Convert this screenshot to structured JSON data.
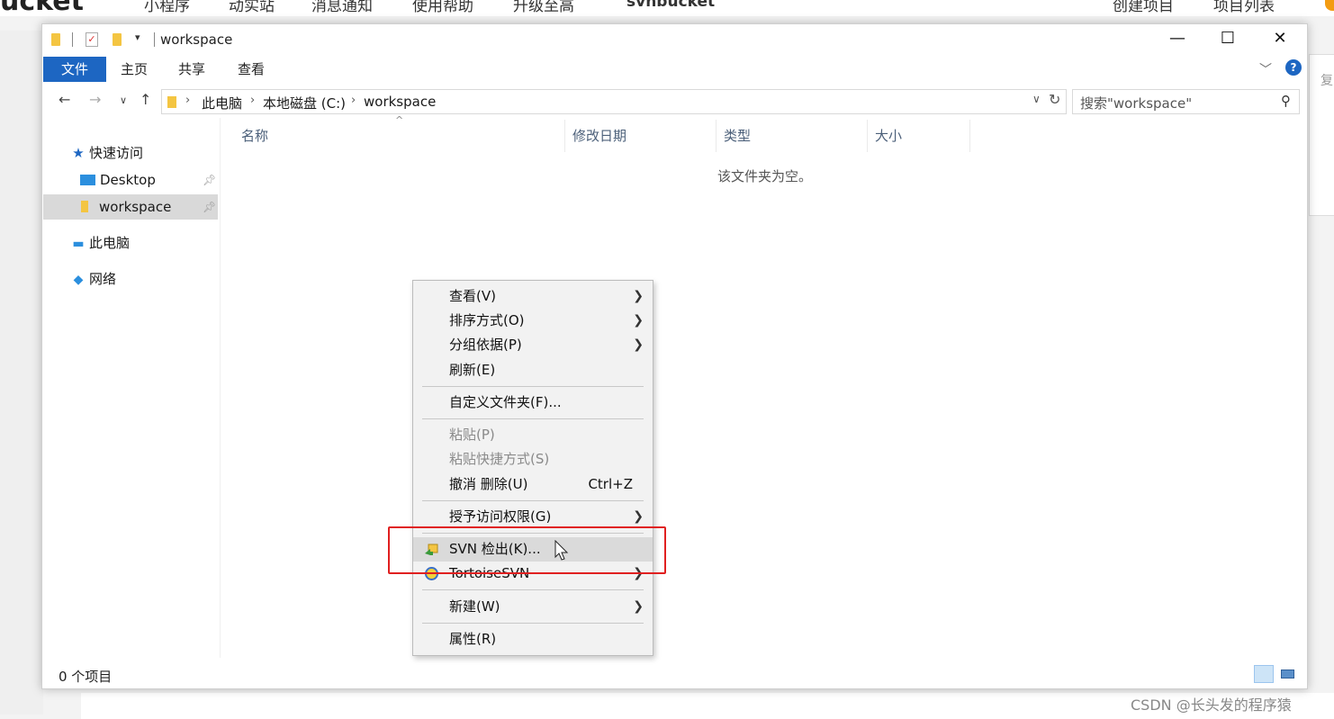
{
  "background_page": {
    "logo": "ucket",
    "nav_items": [
      "小程序",
      "动实站",
      "消息通知",
      "使用帮助",
      "升级至高",
      "svnbucket"
    ],
    "right_items": [
      "创建项目",
      "项目列表"
    ],
    "side_tab": "复"
  },
  "window": {
    "title": "workspace",
    "minimize": "—",
    "maximize": "☐",
    "close": "✕"
  },
  "ribbon": {
    "tabs": [
      "文件",
      "主页",
      "共享",
      "查看"
    ],
    "help": "?"
  },
  "address": {
    "crumbs": [
      "此电脑",
      "本地磁盘 (C:)",
      "workspace"
    ],
    "search_placeholder": "搜索\"workspace\""
  },
  "nav_pane": {
    "quick_access": "快速访问",
    "desktop": "Desktop",
    "workspace": "workspace",
    "this_pc": "此电脑",
    "network": "网络"
  },
  "columns": [
    "名称",
    "修改日期",
    "类型",
    "大小"
  ],
  "empty_message": "该文件夹为空。",
  "status": "0 个项目",
  "context_menu": {
    "view": "查看(V)",
    "sort": "排序方式(O)",
    "group": "分组依据(P)",
    "refresh": "刷新(E)",
    "customize": "自定义文件夹(F)...",
    "paste": "粘贴(P)",
    "paste_shortcut": "粘贴快捷方式(S)",
    "undo": "撤消 删除(U)",
    "undo_shortcut": "Ctrl+Z",
    "grant_access": "授予访问权限(G)",
    "svn_checkout": "SVN 检出(K)...",
    "tortoise": "TortoiseSVN",
    "new": "新建(W)",
    "properties": "属性(R)"
  },
  "watermark": "CSDN @长头发的程序猿",
  "colors": {
    "accent": "#1d66c2",
    "highlight_box": "#e02020",
    "folder": "#f4c542"
  }
}
